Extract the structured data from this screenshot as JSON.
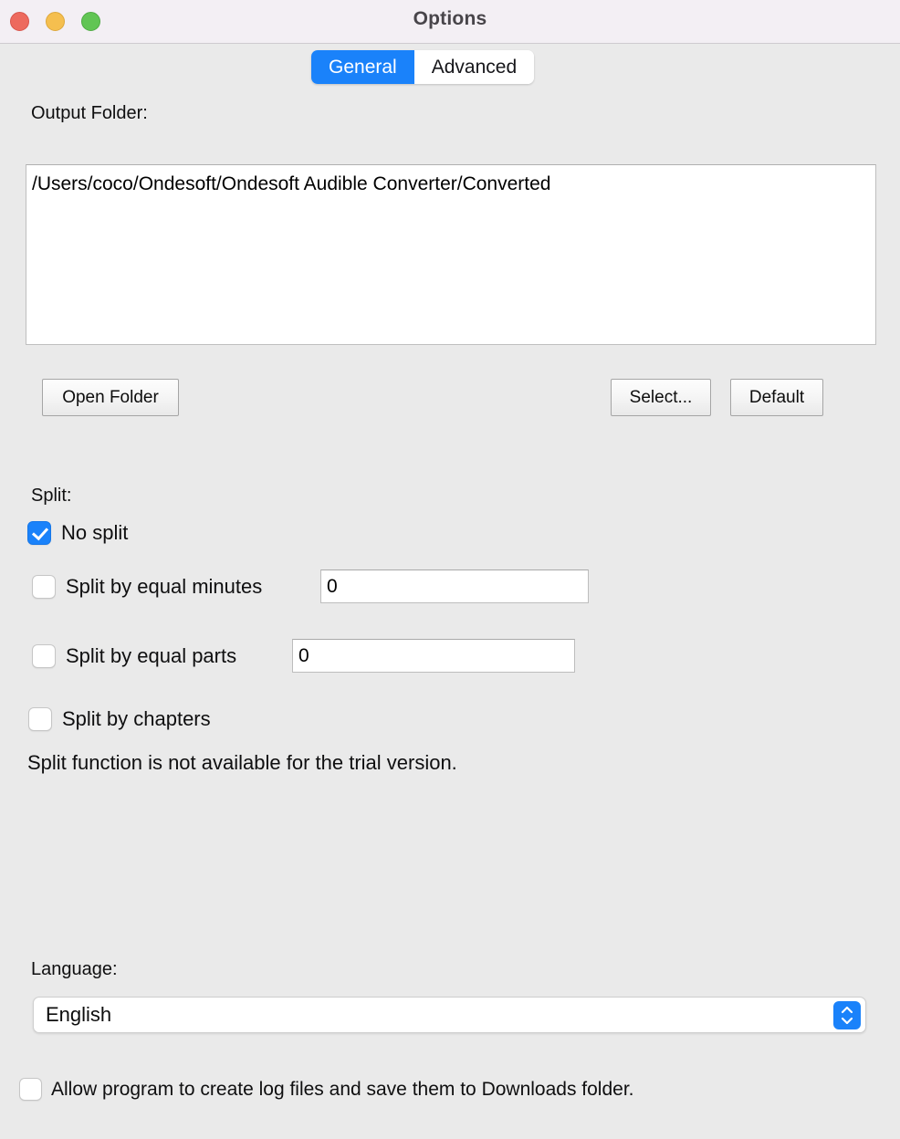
{
  "window": {
    "title": "Options",
    "traffic_lights": [
      {
        "name": "close",
        "color": "#ed6a5e"
      },
      {
        "name": "minimize",
        "color": "#f5bf4f"
      },
      {
        "name": "zoom",
        "color": "#61c554"
      }
    ]
  },
  "tabs": [
    {
      "label": "General",
      "selected": true
    },
    {
      "label": "Advanced",
      "selected": false
    }
  ],
  "output_folder": {
    "label": "Output Folder:",
    "path": "/Users/coco/Ondesoft/Ondesoft Audible Converter/Converted",
    "buttons": {
      "open_folder": "Open Folder",
      "select": "Select...",
      "default": "Default"
    }
  },
  "split": {
    "label": "Split:",
    "options": [
      {
        "label": "No split",
        "checked": true
      },
      {
        "label": "Split by equal minutes",
        "checked": false,
        "value": "0"
      },
      {
        "label": "Split by equal parts",
        "checked": false,
        "value": "0"
      },
      {
        "label": "Split by chapters",
        "checked": false
      }
    ],
    "notice": "Split function is not available for the trial version."
  },
  "language": {
    "label": "Language:",
    "selected": "English"
  },
  "logging": {
    "label": "Allow program to create log files and save them to Downloads folder.",
    "checked": false
  },
  "colors": {
    "accent": "#1a82fa",
    "titlebar": "#f3eff4",
    "window_background": "#eaeaea"
  }
}
